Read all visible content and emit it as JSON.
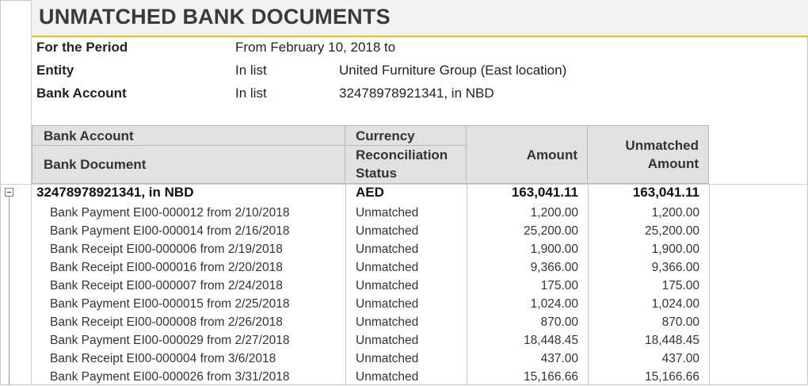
{
  "report": {
    "title": "UNMATCHED BANK DOCUMENTS",
    "params": [
      {
        "label": "For the Period",
        "op": "From February 10, 2018 to",
        "value": ""
      },
      {
        "label": "Entity",
        "op": "In list",
        "value": "United Furniture Group (East location)"
      },
      {
        "label": "Bank Account",
        "op": "In list",
        "value": "32478978921341, in NBD"
      }
    ]
  },
  "table": {
    "headers": {
      "bank_account": "Bank Account",
      "bank_document": "Bank Document",
      "currency": "Currency",
      "recon_status_line1": "Reconciliation",
      "recon_status_line2": "Status",
      "amount": "Amount",
      "unmatched_line1": "Unmatched",
      "unmatched_line2": "Amount"
    },
    "group": {
      "account": "32478978921341, in NBD",
      "currency": "AED",
      "amount": "163,041.11",
      "unmatched": "163,041.11"
    },
    "rows": [
      {
        "doc": "Bank Payment EI00-000012 from 2/10/2018",
        "status": "Unmatched",
        "amount": "1,200.00",
        "unmatched": "1,200.00"
      },
      {
        "doc": "Bank Payment EI00-000014 from 2/16/2018",
        "status": "Unmatched",
        "amount": "25,200.00",
        "unmatched": "25,200.00"
      },
      {
        "doc": "Bank Receipt EI00-000006 from 2/19/2018",
        "status": "Unmatched",
        "amount": "1,900.00",
        "unmatched": "1,900.00"
      },
      {
        "doc": "Bank Receipt EI00-000016 from 2/20/2018",
        "status": "Unmatched",
        "amount": "9,366.00",
        "unmatched": "9,366.00"
      },
      {
        "doc": "Bank Receipt EI00-000007 from 2/24/2018",
        "status": "Unmatched",
        "amount": "175.00",
        "unmatched": "175.00"
      },
      {
        "doc": "Bank Payment EI00-000015 from 2/25/2018",
        "status": "Unmatched",
        "amount": "1,024.00",
        "unmatched": "1,024.00"
      },
      {
        "doc": "Bank Receipt EI00-000008 from 2/26/2018",
        "status": "Unmatched",
        "amount": "870.00",
        "unmatched": "870.00"
      },
      {
        "doc": "Bank Payment EI00-000029 from 2/27/2018",
        "status": "Unmatched",
        "amount": "18,448.45",
        "unmatched": "18,448.45"
      },
      {
        "doc": "Bank Receipt EI00-000004 from 3/6/2018",
        "status": "Unmatched",
        "amount": "437.00",
        "unmatched": "437.00"
      },
      {
        "doc": "Bank Payment EI00-000026 from 3/31/2018",
        "status": "Unmatched",
        "amount": "15,166.66",
        "unmatched": "15,166.66"
      }
    ]
  },
  "colors": {
    "accent": "#f0c400",
    "header_bg": "#e1e1e1",
    "title_bg": "#f2f2f2"
  },
  "icons": {
    "collapse": "minus-box-icon"
  }
}
